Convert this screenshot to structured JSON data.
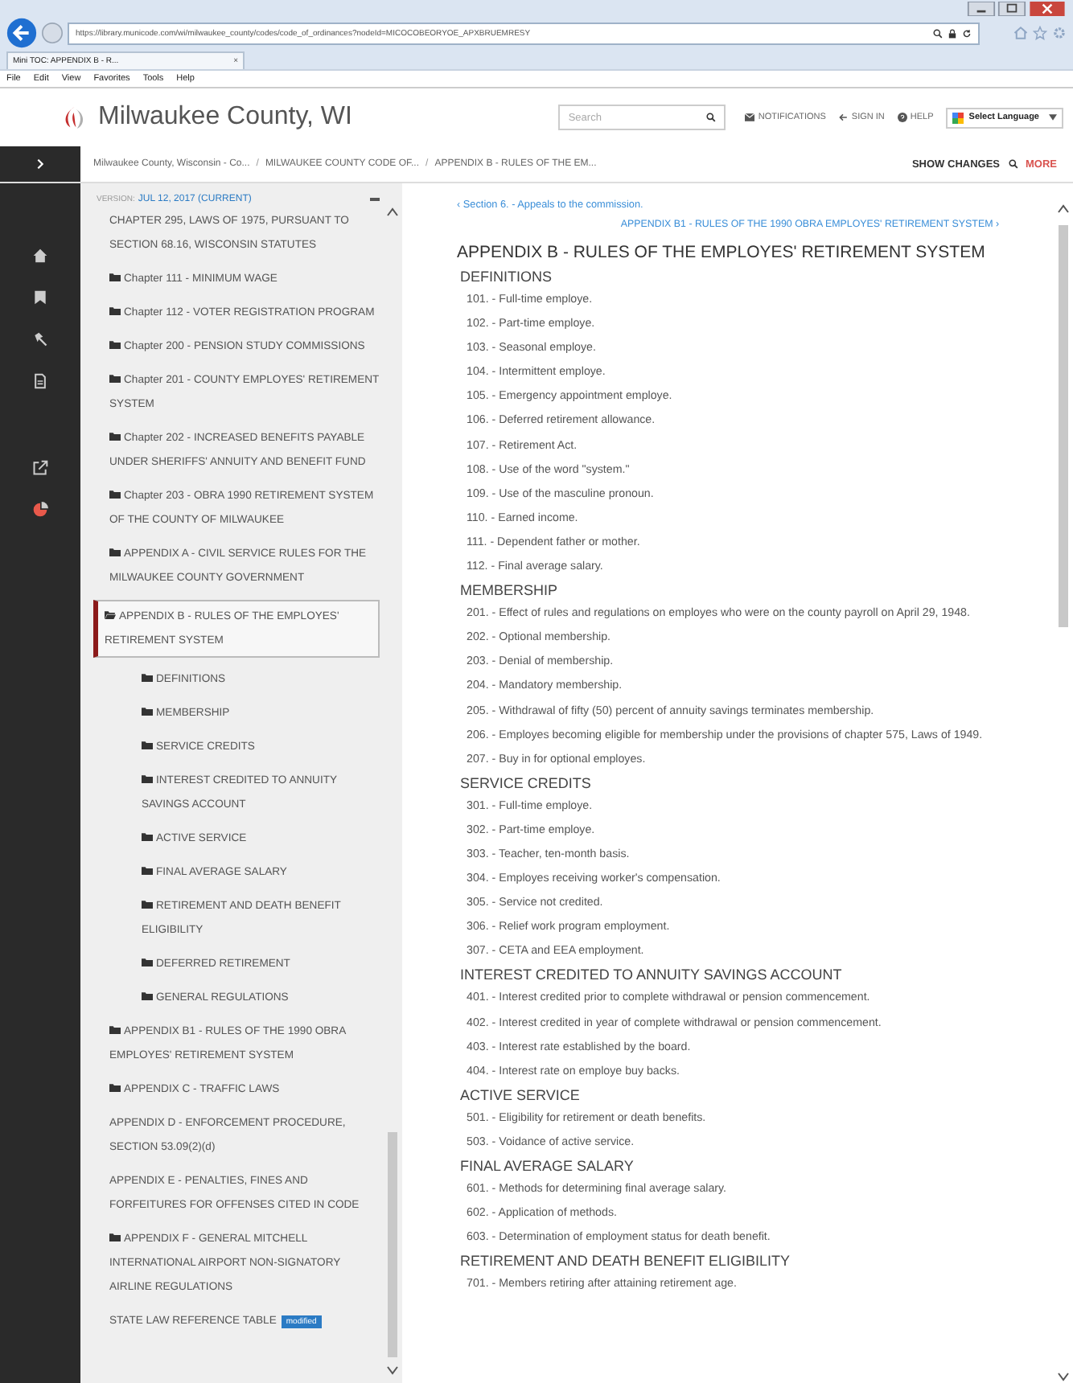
{
  "browser": {
    "url": "https://library.municode.com/wi/milwaukee_county/codes/code_of_ordinances?nodeId=MICOCOBEORYOE_APXBRUEMRESY",
    "tab_title": "Mini TOC: APPENDIX B - R...",
    "tab_close": "×",
    "menu": [
      "File",
      "Edit",
      "View",
      "Favorites",
      "Tools",
      "Help"
    ]
  },
  "site": {
    "title": "Milwaukee County, WI",
    "search": {
      "placeholder": "Search"
    },
    "nav": [
      "NOTIFICATIONS",
      "SIGN IN",
      "HELP"
    ],
    "language": "Select Language"
  },
  "breadcrumb_separator": "/",
  "breadcrumbs": [
    "Milwaukee County, Wisconsin - Co...",
    "MILWAUKEE COUNTY CODE OF...",
    "APPENDIX B - RULES OF THE EM..."
  ],
  "actions": {
    "show_changes": "SHOW CHANGES",
    "more": "MORE"
  },
  "sidebar": {
    "version_label": "VERSION:",
    "version": "JUL 12, 2017 (CURRENT)",
    "items": [
      {
        "label": "CHAPTER 295, LAWS OF 1975, PURSUANT TO SECTION 68.16, WISCONSIN STATUTES",
        "kind": "text",
        "selected": false
      },
      {
        "label": "Chapter 111 - MINIMUM WAGE",
        "kind": "folder",
        "selected": false,
        "expanded": false
      },
      {
        "label": "Chapter 112 - VOTER REGISTRATION PROGRAM",
        "kind": "folder",
        "selected": false,
        "expanded": false
      },
      {
        "label": "Chapter 200 - PENSION STUDY COMMISSIONS",
        "kind": "folder",
        "selected": false,
        "expanded": false
      },
      {
        "label": "Chapter 201 - COUNTY EMPLOYES' RETIREMENT SYSTEM",
        "kind": "folder",
        "selected": false,
        "expanded": false
      },
      {
        "label": "Chapter 202 - INCREASED BENEFITS PAYABLE UNDER SHERIFFS' ANNUITY AND BENEFIT FUND",
        "kind": "folder",
        "selected": false,
        "expanded": false
      },
      {
        "label": "Chapter 203 - OBRA 1990 RETIREMENT SYSTEM OF THE COUNTY OF MILWAUKEE",
        "kind": "folder",
        "selected": false,
        "expanded": false
      },
      {
        "label": "APPENDIX A - CIVIL SERVICE RULES FOR THE MILWAUKEE COUNTY GOVERNMENT",
        "kind": "folder",
        "selected": false,
        "expanded": false
      },
      {
        "label": "APPENDIX B - RULES OF THE EMPLOYES' RETIREMENT SYSTEM",
        "kind": "folder",
        "selected": true,
        "expanded": true,
        "children": [
          {
            "label": "DEFINITIONS",
            "kind": "folder",
            "selected": false,
            "expanded": false
          },
          {
            "label": "MEMBERSHIP",
            "kind": "folder",
            "selected": false,
            "expanded": false
          },
          {
            "label": "SERVICE CREDITS",
            "kind": "folder",
            "selected": false,
            "expanded": false
          },
          {
            "label": "INTEREST CREDITED TO ANNUITY SAVINGS ACCOUNT",
            "kind": "folder",
            "selected": false,
            "expanded": false
          },
          {
            "label": "ACTIVE SERVICE",
            "kind": "folder",
            "selected": false,
            "expanded": false
          },
          {
            "label": "FINAL AVERAGE SALARY",
            "kind": "folder",
            "selected": false,
            "expanded": false
          },
          {
            "label": "RETIREMENT AND DEATH BENEFIT ELIGIBILITY",
            "kind": "folder",
            "selected": false,
            "expanded": false
          },
          {
            "label": "DEFERRED RETIREMENT",
            "kind": "folder",
            "selected": false,
            "expanded": false
          },
          {
            "label": "GENERAL REGULATIONS",
            "kind": "folder",
            "selected": false,
            "expanded": false
          }
        ]
      },
      {
        "label": "APPENDIX B1 - RULES OF THE 1990 OBRA EMPLOYES' RETIREMENT SYSTEM",
        "kind": "folder",
        "selected": false,
        "expanded": false
      },
      {
        "label": "APPENDIX C - TRAFFIC LAWS",
        "kind": "folder",
        "selected": false,
        "expanded": false
      },
      {
        "label": "APPENDIX D - ENFORCEMENT PROCEDURE, SECTION 53.09(2)(d)",
        "kind": "text",
        "selected": false
      },
      {
        "label": "APPENDIX E - PENALTIES, FINES AND FORFEITURES FOR OFFENSES CITED IN CODE",
        "kind": "text",
        "selected": false
      },
      {
        "label": "APPENDIX F - GENERAL MITCHELL INTERNATIONAL AIRPORT NON-SIGNATORY AIRLINE REGULATIONS",
        "kind": "folder",
        "selected": false,
        "expanded": false
      },
      {
        "label": "STATE LAW REFERENCE TABLE",
        "kind": "text",
        "selected": false,
        "badge": "modified"
      }
    ]
  },
  "content": {
    "prev": {
      "arrow": "‹",
      "label": "Section 6. - Appeals to the commission."
    },
    "next": {
      "arrow": "›",
      "label": "APPENDIX B1 - RULES OF THE 1990 OBRA EMPLOYES' RETIREMENT SYSTEM"
    },
    "title": "APPENDIX B - RULES OF THE EMPLOYES' RETIREMENT SYSTEM",
    "sections": [
      {
        "heading": "DEFINITIONS",
        "entries": [
          "101. - Full-time employe.",
          "102. - Part-time employe.",
          "103. - Seasonal employe.",
          "104. - Intermittent employe.",
          "105. - Emergency appointment employe.",
          "106. - Deferred retirement allowance.",
          "107. - Retirement Act.",
          "108. - Use of the word \"system.\"",
          "109. - Use of the masculine pronoun.",
          "110. - Earned income.",
          "111. - Dependent father or mother.",
          "112. - Final average salary."
        ]
      },
      {
        "heading": "MEMBERSHIP",
        "entries": [
          "201. - Effect of rules and regulations on employes who were on the county payroll on April 29, 1948.",
          "202. - Optional membership.",
          "203. - Denial of membership.",
          "204. - Mandatory membership.",
          "205. - Withdrawal of fifty (50) percent of annuity savings terminates membership.",
          "206. - Employes becoming eligible for membership under the provisions of chapter 575, Laws of 1949.",
          "207. - Buy in for optional employes."
        ]
      },
      {
        "heading": "SERVICE CREDITS",
        "entries": [
          "301. - Full-time employe.",
          "302. - Part-time employe.",
          "303. - Teacher, ten-month basis.",
          "304. - Employes receiving worker's compensation.",
          "305. - Service not credited.",
          "306. - Relief work program employment.",
          "307. - CETA and EEA employment."
        ]
      },
      {
        "heading": "INTEREST CREDITED TO ANNUITY SAVINGS ACCOUNT",
        "entries": [
          "401. - Interest credited prior to complete withdrawal or pension commencement.",
          "402. - Interest credited in year of complete withdrawal or pension commencement.",
          "403. - Interest rate established by the board.",
          "404. - Interest rate on employe buy backs."
        ]
      },
      {
        "heading": "ACTIVE SERVICE",
        "entries": [
          "501. - Eligibility for retirement or death benefits.",
          "503. - Voidance of active service."
        ]
      },
      {
        "heading": "FINAL AVERAGE SALARY",
        "entries": [
          "601. - Methods for determining final average salary.",
          "602. - Application of methods.",
          "603. - Determination of employment status for death benefit."
        ]
      },
      {
        "heading": "RETIREMENT AND DEATH BENEFIT ELIGIBILITY",
        "entries": [
          "701. - Members retiring after attaining retirement age."
        ]
      }
    ]
  }
}
